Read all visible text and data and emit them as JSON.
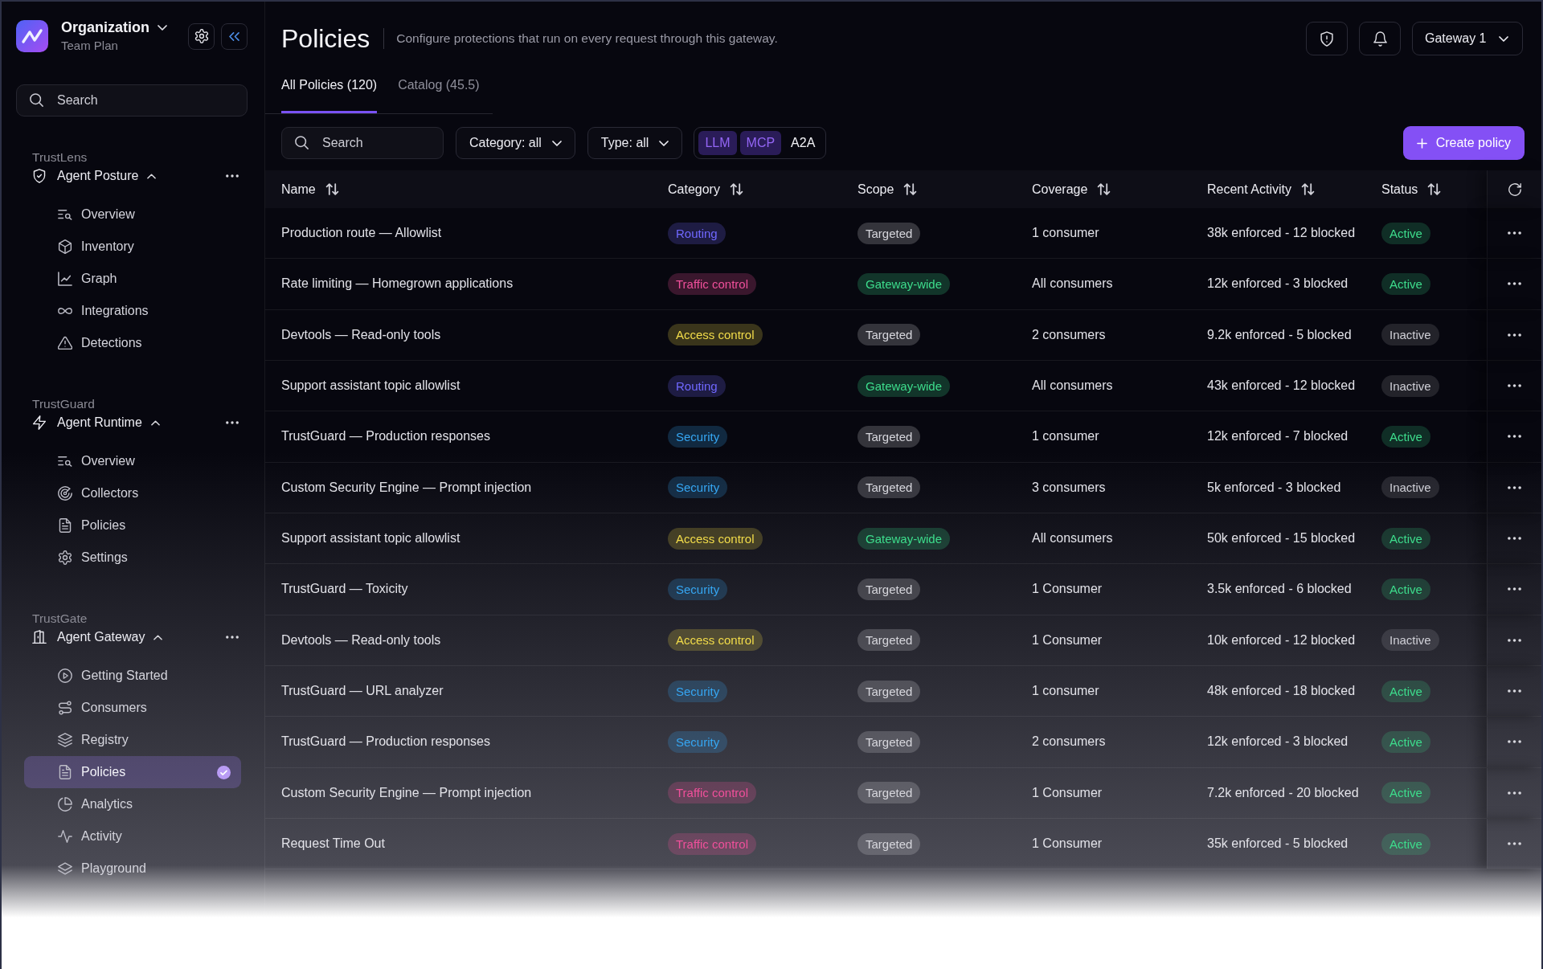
{
  "sidebar": {
    "organization": {
      "name": "Organization",
      "plan": "Team Plan"
    },
    "search": {
      "placeholder": "Search"
    },
    "sections": [
      {
        "product": "TrustLens",
        "title": "Agent Posture",
        "expanded": true,
        "items": [
          {
            "label": "Overview",
            "selected": false
          },
          {
            "label": "Inventory",
            "selected": false
          },
          {
            "label": "Graph",
            "selected": false
          },
          {
            "label": "Integrations",
            "selected": false
          },
          {
            "label": "Detections",
            "selected": false
          }
        ]
      },
      {
        "product": "TrustGuard",
        "title": "Agent Runtime",
        "expanded": true,
        "items": [
          {
            "label": "Overview",
            "selected": false
          },
          {
            "label": "Collectors",
            "selected": false
          },
          {
            "label": "Policies",
            "selected": false
          },
          {
            "label": "Settings",
            "selected": false
          }
        ]
      },
      {
        "product": "TrustGate",
        "title": "Agent Gateway",
        "expanded": true,
        "items": [
          {
            "label": "Getting Started",
            "selected": false
          },
          {
            "label": "Consumers",
            "selected": false
          },
          {
            "label": "Registry",
            "selected": false
          },
          {
            "label": "Policies",
            "selected": true
          },
          {
            "label": "Analytics",
            "selected": false
          },
          {
            "label": "Activity",
            "selected": false
          },
          {
            "label": "Playground",
            "selected": false
          }
        ]
      }
    ]
  },
  "header": {
    "title": "Policies",
    "subtitle": "Configure protections that run on every request through this gateway.",
    "gateway": "Gateway 1"
  },
  "tabs": [
    {
      "label": "All Policies (120)",
      "selected": true
    },
    {
      "label": "Catalog (45.5)",
      "selected": false
    }
  ],
  "toolbar": {
    "search": {
      "placeholder": "Search"
    },
    "filters": [
      {
        "label": "Category: all"
      },
      {
        "label": "Type: all"
      }
    ],
    "types": [
      {
        "label": "LLM",
        "selected": true
      },
      {
        "label": "MCP",
        "selected": true
      },
      {
        "label": "A2A",
        "selected": false
      }
    ],
    "create_button": "Create policy"
  },
  "table": {
    "columns": [
      "Name",
      "Category",
      "Scope",
      "Coverage",
      "Recent Activity",
      "Status"
    ],
    "rows": [
      {
        "name": "Production route — Allowlist",
        "category": {
          "label": "Routing",
          "kind": "routing"
        },
        "scope": {
          "label": "Targeted",
          "kind": "targeted"
        },
        "coverage": "1 consumer",
        "recent_activity": "38k enforced - 12 blocked",
        "status": {
          "label": "Active",
          "active": true
        }
      },
      {
        "name": "Rate limiting — Homegrown applications",
        "category": {
          "label": "Traffic control",
          "kind": "traffic"
        },
        "scope": {
          "label": "Gateway-wide",
          "kind": "wide"
        },
        "coverage": "All consumers",
        "recent_activity": "12k enforced - 3 blocked",
        "status": {
          "label": "Active",
          "active": true
        }
      },
      {
        "name": "Devtools — Read-only tools",
        "category": {
          "label": "Access control",
          "kind": "access"
        },
        "scope": {
          "label": "Targeted",
          "kind": "targeted"
        },
        "coverage": "2 consumers",
        "recent_activity": "9.2k enforced - 5 blocked",
        "status": {
          "label": "Inactive",
          "active": false
        }
      },
      {
        "name": "Support assistant topic allowlist",
        "category": {
          "label": "Routing",
          "kind": "routing"
        },
        "scope": {
          "label": "Gateway-wide",
          "kind": "wide"
        },
        "coverage": "All consumers",
        "recent_activity": "43k enforced - 12 blocked",
        "status": {
          "label": "Inactive",
          "active": false
        }
      },
      {
        "name": "TrustGuard — Production responses",
        "category": {
          "label": "Security",
          "kind": "security"
        },
        "scope": {
          "label": "Targeted",
          "kind": "targeted"
        },
        "coverage": "1 consumer",
        "recent_activity": "12k enforced - 7 blocked",
        "status": {
          "label": "Active",
          "active": true
        }
      },
      {
        "name": "Custom Security Engine — Prompt injection",
        "category": {
          "label": "Security",
          "kind": "security"
        },
        "scope": {
          "label": "Targeted",
          "kind": "targeted"
        },
        "coverage": "3 consumers",
        "recent_activity": "5k enforced - 3 blocked",
        "status": {
          "label": "Inactive",
          "active": false
        }
      },
      {
        "name": "Support assistant topic allowlist",
        "category": {
          "label": "Access control",
          "kind": "access"
        },
        "scope": {
          "label": "Gateway-wide",
          "kind": "wide"
        },
        "coverage": "All consumers",
        "recent_activity": "50k enforced - 15 blocked",
        "status": {
          "label": "Active",
          "active": true
        }
      },
      {
        "name": "TrustGuard — Toxicity",
        "category": {
          "label": "Security",
          "kind": "security"
        },
        "scope": {
          "label": "Targeted",
          "kind": "targeted"
        },
        "coverage": "1 Consumer",
        "recent_activity": "3.5k enforced - 6 blocked",
        "status": {
          "label": "Active",
          "active": true
        }
      },
      {
        "name": "Devtools — Read-only tools",
        "category": {
          "label": "Access control",
          "kind": "access"
        },
        "scope": {
          "label": "Targeted",
          "kind": "targeted"
        },
        "coverage": "1 Consumer",
        "recent_activity": "10k enforced - 12 blocked",
        "status": {
          "label": "Inactive",
          "active": false
        }
      },
      {
        "name": "TrustGuard — URL analyzer",
        "category": {
          "label": "Security",
          "kind": "security"
        },
        "scope": {
          "label": "Targeted",
          "kind": "targeted"
        },
        "coverage": "1 consumer",
        "recent_activity": "48k enforced - 18 blocked",
        "status": {
          "label": "Active",
          "active": true
        }
      },
      {
        "name": "TrustGuard — Production responses",
        "category": {
          "label": "Security",
          "kind": "security"
        },
        "scope": {
          "label": "Targeted",
          "kind": "targeted"
        },
        "coverage": "2 consumers",
        "recent_activity": "12k enforced - 3 blocked",
        "status": {
          "label": "Active",
          "active": true
        }
      },
      {
        "name": "Custom Security Engine — Prompt injection",
        "category": {
          "label": "Traffic control",
          "kind": "traffic"
        },
        "scope": {
          "label": "Targeted",
          "kind": "targeted"
        },
        "coverage": "1 Consumer",
        "recent_activity": "7.2k enforced - 20 blocked",
        "status": {
          "label": "Active",
          "active": true
        }
      },
      {
        "name": "Request Time Out",
        "category": {
          "label": "Traffic control",
          "kind": "traffic"
        },
        "scope": {
          "label": "Targeted",
          "kind": "targeted"
        },
        "coverage": "1 Consumer",
        "recent_activity": "35k enforced - 5 blocked",
        "status": {
          "label": "Active",
          "active": true
        }
      }
    ]
  }
}
